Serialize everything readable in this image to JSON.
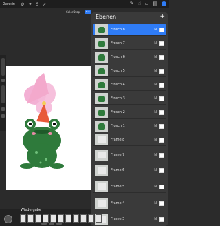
{
  "topbar": {
    "gallery_label": "Galerie"
  },
  "canvas_title": "ColorDrop",
  "new_label": "Neu",
  "layers": {
    "title": "Ebenen",
    "add_label": "+",
    "rows": [
      {
        "name": "Frosch 8",
        "mark": "N",
        "selected": true
      },
      {
        "name": "Frosch 7",
        "mark": "N"
      },
      {
        "name": "Frosch 6",
        "mark": "N"
      },
      {
        "name": "Frosch 5",
        "mark": "N"
      },
      {
        "name": "Frosch 4",
        "mark": "N"
      },
      {
        "name": "Frosch 3",
        "mark": "N"
      },
      {
        "name": "Frosch 2",
        "mark": "N"
      },
      {
        "name": "Frosch 1",
        "mark": "N"
      },
      {
        "name": "Frame 8",
        "mark": "N"
      },
      {
        "name": "Frame 7",
        "mark": "N"
      },
      {
        "name": "Frame 6",
        "mark": "N"
      },
      {
        "name": "Frame 5",
        "mark": "N"
      },
      {
        "name": "Frame 4",
        "mark": "N"
      },
      {
        "name": "Frame 3",
        "mark": "N"
      }
    ]
  },
  "playback_label": "Wiedergabe",
  "colors": {
    "accent": "#2f7cf6",
    "frog_green": "#2e7a3b",
    "pink": "#f2a7cf"
  }
}
